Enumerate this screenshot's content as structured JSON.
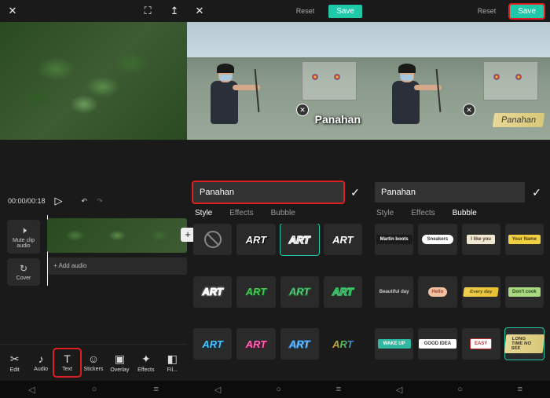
{
  "panel1": {
    "topbar": {
      "close": "✕",
      "expand": "⛶",
      "upload": "↥"
    },
    "timecode": "00:00/00:18",
    "play": "▷",
    "undo": "↶",
    "redo": "↷",
    "track_btns": {
      "mute": {
        "icon": "🕨",
        "label": "Mute clip audio"
      },
      "cover": {
        "icon": "↻",
        "label": "Cover"
      }
    },
    "add_thumb": "+",
    "audio_track": "+ Add audio",
    "tools": [
      {
        "icon": "✂",
        "label": "Edit",
        "name": "tool-edit"
      },
      {
        "icon": "♪",
        "label": "Audio",
        "name": "tool-audio"
      },
      {
        "icon": "T",
        "label": "Text",
        "name": "tool-text",
        "highlight": true
      },
      {
        "icon": "☺",
        "label": "Stickers",
        "name": "tool-stickers"
      },
      {
        "icon": "▣",
        "label": "Overlay",
        "name": "tool-overlay"
      },
      {
        "icon": "✦",
        "label": "Effects",
        "name": "tool-effects"
      },
      {
        "icon": "◧",
        "label": "Fil...",
        "name": "tool-filter"
      }
    ]
  },
  "panel2": {
    "topbar": {
      "close": "✕",
      "reset": "Reset",
      "save": "Save"
    },
    "caption": "Panahan",
    "text_input": "Panahan",
    "check": "✓",
    "tabs": {
      "style": "Style",
      "effects": "Effects",
      "bubble": "Bubble"
    },
    "active_tab": "Style",
    "swatch_label": "ART",
    "swatches": [
      {
        "cls": "none",
        "name": "style-none"
      },
      {
        "cls": "sw-white",
        "name": "style-white"
      },
      {
        "cls": "sw-outline",
        "name": "style-outline",
        "selected": true,
        "highlight": true
      },
      {
        "cls": "sw-plain",
        "name": "style-plain"
      },
      {
        "cls": "sw-white-out",
        "name": "style-white-outline"
      },
      {
        "cls": "sw-green",
        "name": "style-green"
      },
      {
        "cls": "sw-green-out",
        "name": "style-green-outline"
      },
      {
        "cls": "sw-green-stroke",
        "name": "style-green-stroke"
      },
      {
        "cls": "sw-blue",
        "name": "style-blue"
      },
      {
        "cls": "sw-pink",
        "name": "style-pink"
      },
      {
        "cls": "sw-blue-out",
        "name": "style-blue-outline"
      },
      {
        "cls": "sw-rainbow",
        "name": "style-rainbow"
      }
    ]
  },
  "panel3": {
    "topbar": {
      "reset": "Reset",
      "save": "Save",
      "save_highlight": true
    },
    "caption": "Panahan",
    "text_input": "Panahan",
    "check": "✓",
    "tabs": {
      "style": "Style",
      "effects": "Effects",
      "bubble": "Bubble"
    },
    "active_tab": "Bubble",
    "bubbles": [
      {
        "cls": "b-black",
        "label": "Martin boots",
        "name": "bubble-black"
      },
      {
        "cls": "b-white-round",
        "label": "Sneakers",
        "name": "bubble-white-round"
      },
      {
        "cls": "b-cream",
        "label": "I like you",
        "name": "bubble-cream"
      },
      {
        "cls": "b-yellow",
        "label": "Your Name",
        "name": "bubble-yellow"
      },
      {
        "cls": "b-plain",
        "label": "Beautiful day",
        "name": "bubble-plain"
      },
      {
        "cls": "b-pink-blob",
        "label": "Hello",
        "name": "bubble-pink"
      },
      {
        "cls": "b-yel-banner",
        "label": "Every day",
        "name": "bubble-banner"
      },
      {
        "cls": "b-green-tag",
        "label": "Don't cook",
        "name": "bubble-green"
      },
      {
        "cls": "b-teal",
        "label": "WAKE UP",
        "name": "bubble-teal"
      },
      {
        "cls": "b-white-ribbon",
        "label": "GOOD IDEA",
        "name": "bubble-ribbon"
      },
      {
        "cls": "b-red-flag",
        "label": "EASY",
        "name": "bubble-flag"
      },
      {
        "cls": "b-banner2",
        "label": "LONG TIME NO SEE",
        "name": "bubble-banner2",
        "selected": true,
        "highlight": true
      }
    ]
  },
  "nav": {
    "back": "◁",
    "home": "○",
    "recent": "≡"
  }
}
